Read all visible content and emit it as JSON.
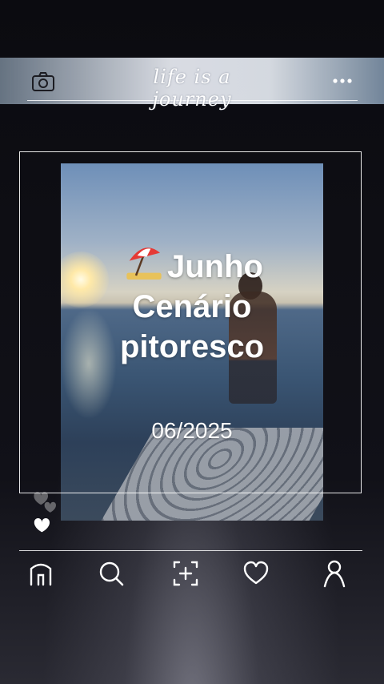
{
  "header": {
    "title": "life is a journey",
    "camera_icon": "camera-icon",
    "more_icon": "more-horizontal-icon"
  },
  "post": {
    "title_line1": "Junho",
    "title_line2": "Cenário",
    "title_line3": "pitoresco",
    "title_emoji": "beach-umbrella-icon",
    "date": "06/2025",
    "hearts_icon": "hearts-icon"
  },
  "nav": {
    "items": [
      {
        "icon": "home-icon"
      },
      {
        "icon": "search-icon"
      },
      {
        "icon": "add-post-icon"
      },
      {
        "icon": "heart-icon"
      },
      {
        "icon": "profile-icon"
      }
    ]
  }
}
